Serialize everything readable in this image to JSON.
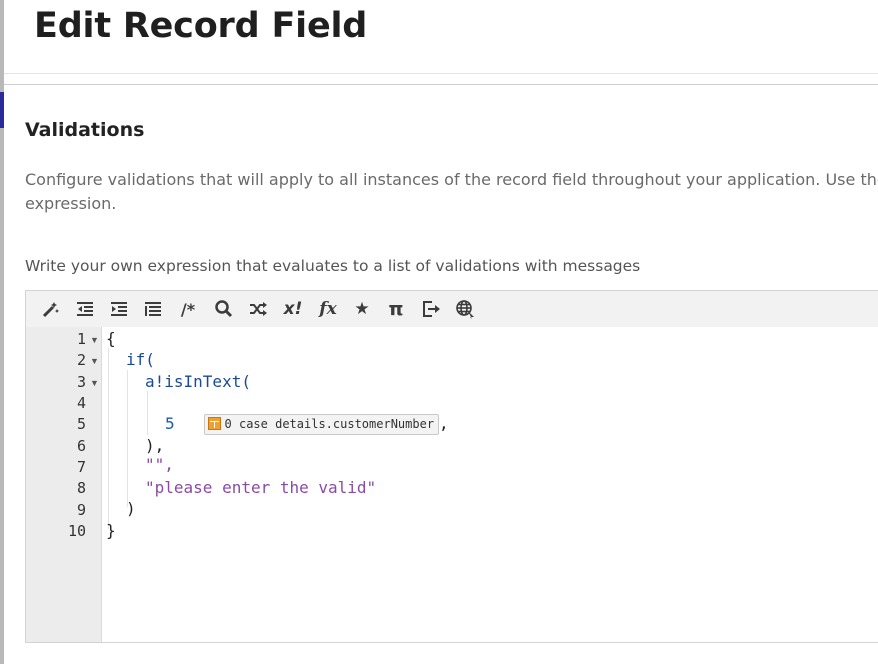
{
  "header": {
    "title": "Edit Record Field"
  },
  "validations": {
    "title": "Validations",
    "description_line1": "Configure validations that will apply to all instances of the record field throughout your application. Use the ap",
    "description_line2": "expression.",
    "expression_label": "Write your own expression that evaluates to a list of validations with messages"
  },
  "toolbar": {
    "buttons": [
      {
        "name": "format-magic-icon"
      },
      {
        "name": "outdent-icon"
      },
      {
        "name": "indent-icon"
      },
      {
        "name": "list-icon"
      },
      {
        "name": "comment-icon",
        "label": "/*"
      },
      {
        "name": "search-icon"
      },
      {
        "name": "shuffle-icon"
      },
      {
        "name": "x-bang-icon",
        "label": "x!"
      },
      {
        "name": "function-icon",
        "label": "fx"
      },
      {
        "name": "star-icon",
        "label": "★"
      },
      {
        "name": "pi-icon",
        "label": "π"
      },
      {
        "name": "export-icon"
      },
      {
        "name": "globe-icon"
      }
    ]
  },
  "editor": {
    "line_numbers": [
      "1",
      "2",
      "3",
      "4",
      "5",
      "6",
      "7",
      "8",
      "9",
      "10"
    ],
    "lines": {
      "l1": "{",
      "l2": "if(",
      "l3": "a!isInText(",
      "l4_chip": "0 case details.customerNumber",
      "l4_suffix": ",",
      "l5": "5",
      "l6": "),",
      "l7": "\"\",",
      "l8": "\"please enter the valid\"",
      "l9": ")",
      "l10": "}"
    }
  },
  "colors": {
    "accent": "#2b2b9e",
    "function": "#1a4a96",
    "string": "#8a4aa6",
    "number": "#1a5aa8",
    "chip_icon": "#f0a030"
  }
}
